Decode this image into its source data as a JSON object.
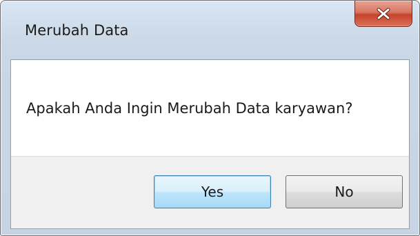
{
  "dialog": {
    "title": "Merubah Data",
    "message": "Apakah Anda Ingin Merubah Data karyawan?",
    "close_icon": "close-icon",
    "buttons": {
      "yes_label": "Yes",
      "no_label": "No"
    }
  },
  "colors": {
    "close_button": "#c6442b",
    "default_button_border": "#3c7fb1",
    "frame": "#cfdcea"
  }
}
